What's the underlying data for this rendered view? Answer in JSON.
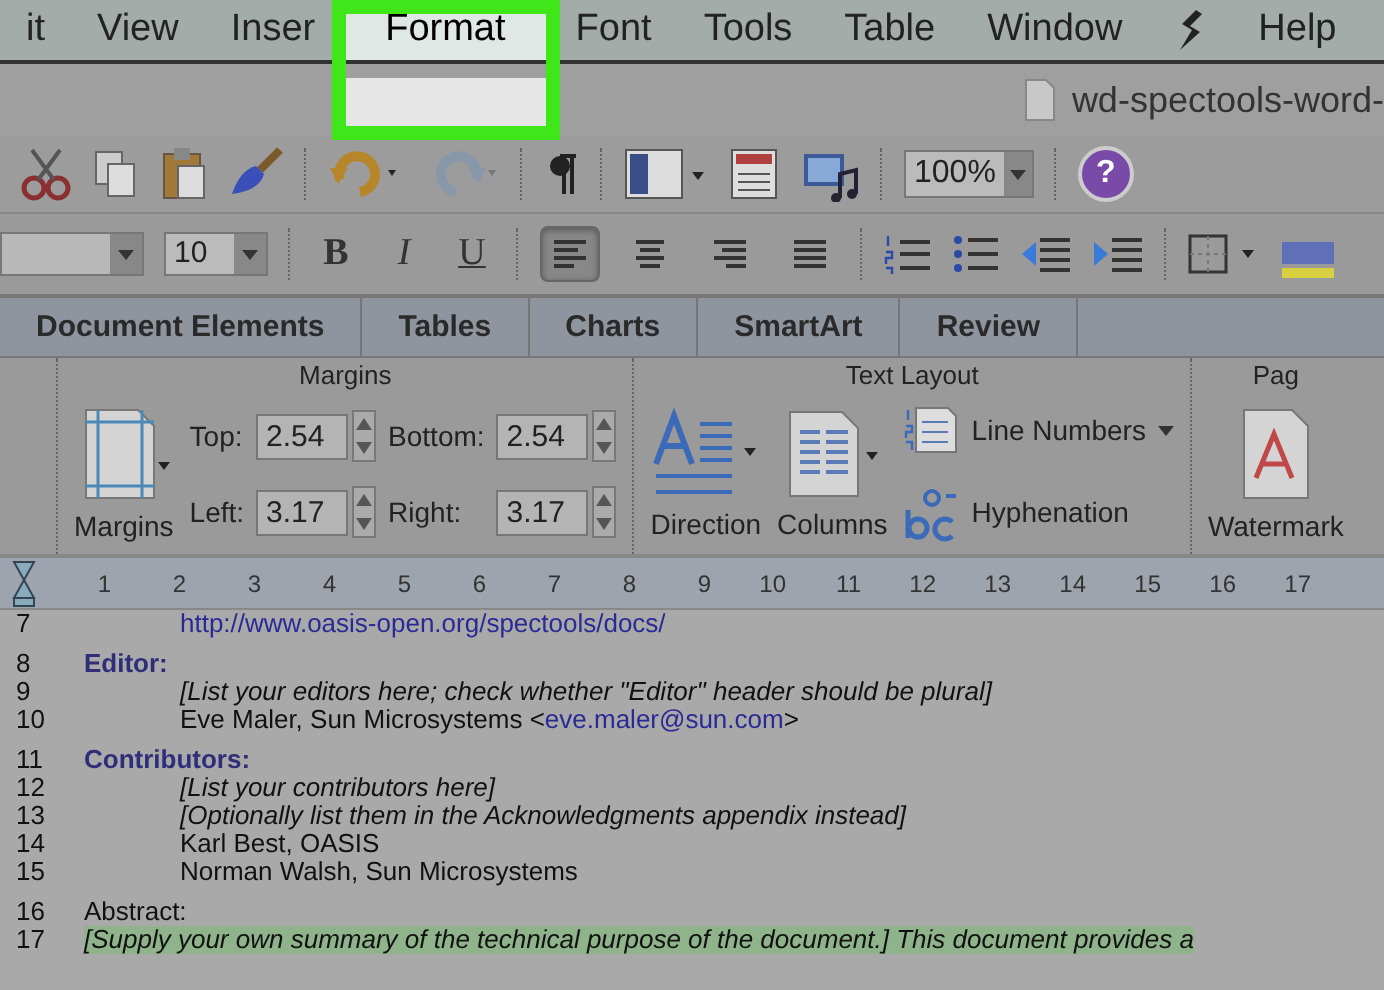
{
  "menu_bar": {
    "items": [
      {
        "kind": "text",
        "label": "it",
        "selected": false
      },
      {
        "kind": "text",
        "label": "View",
        "selected": false
      },
      {
        "kind": "text",
        "label": "Inser",
        "selected": false
      },
      {
        "kind": "text",
        "label": "Format",
        "selected": true
      },
      {
        "kind": "text",
        "label": "Font",
        "selected": false
      },
      {
        "kind": "text",
        "label": "Tools",
        "selected": false
      },
      {
        "kind": "text",
        "label": "Table",
        "selected": false
      },
      {
        "kind": "text",
        "label": "Window",
        "selected": false
      },
      {
        "kind": "icon",
        "selected": false
      },
      {
        "kind": "text",
        "label": "Help",
        "selected": false
      }
    ]
  },
  "document_title": "wd-spectools-word-",
  "toolbar": {
    "zoom": "100%",
    "help": "?"
  },
  "format_bar": {
    "font_size": "10",
    "bold": "B",
    "italic": "I",
    "underline": "U",
    "alignments": [
      {
        "selected": true
      },
      {
        "selected": false
      },
      {
        "selected": false
      },
      {
        "selected": false
      }
    ]
  },
  "ribbon_tabs": [
    {
      "label": "Document Elements",
      "selected": false
    },
    {
      "label": "Tables",
      "selected": false
    },
    {
      "label": "Charts",
      "selected": false
    },
    {
      "label": "SmartArt",
      "selected": false
    },
    {
      "label": "Review",
      "selected": false
    }
  ],
  "margins_group": {
    "title": "Margins",
    "button": "Margins",
    "fields": [
      {
        "label": "Top:",
        "value": "2.54"
      },
      {
        "label": "Bottom:",
        "value": "2.54"
      },
      {
        "label": "Left:",
        "value": "3.17"
      },
      {
        "label": "Right:",
        "value": "3.17"
      }
    ]
  },
  "text_layout_group": {
    "title": "Text Layout",
    "direction": "Direction",
    "columns": "Columns",
    "line_numbers": "Line Numbers",
    "hyphenation": "Hyphenation"
  },
  "page_group": {
    "title": "Pag",
    "watermark": "Watermark"
  },
  "ruler": {
    "ticks": [
      "1",
      "2",
      "3",
      "4",
      "5",
      "6",
      "7",
      "8",
      "9",
      "10",
      "11",
      "12",
      "13",
      "14",
      "15",
      "16",
      "17"
    ]
  },
  "document": {
    "lines": [
      {
        "number": "7",
        "kind": "link",
        "space_before": false,
        "text": "http://www.oasis-open.org/spectools/docs/"
      },
      {
        "number": "8",
        "kind": "heading",
        "space_before": true,
        "text": "Editor:"
      },
      {
        "number": "9",
        "kind": "note",
        "space_before": false,
        "text": "[List your editors here; check whether \"Editor\" header should be plural]"
      },
      {
        "number": "10",
        "kind": "person",
        "space_before": false,
        "text": "Eve Maler, Sun Microsystems <",
        "link": "eve.maler@sun.com",
        "after": ">"
      },
      {
        "number": "11",
        "kind": "heading",
        "space_before": true,
        "text": "Contributors:"
      },
      {
        "number": "12",
        "kind": "note",
        "space_before": false,
        "text": "[List your contributors here]"
      },
      {
        "number": "13",
        "kind": "note",
        "space_before": false,
        "text": "[Optionally list them in the Acknowledgments appendix instead]"
      },
      {
        "number": "14",
        "kind": "plain",
        "space_before": false,
        "text": "Karl Best, OASIS"
      },
      {
        "number": "15",
        "kind": "plain",
        "space_before": false,
        "text": "Norman Walsh, Sun Microsystems"
      },
      {
        "number": "16",
        "kind": "label",
        "space_before": true,
        "text": "Abstract:"
      },
      {
        "number": "17",
        "kind": "highlight",
        "space_before": false,
        "text": "[Supply your own summary of the technical purpose of the document.] This document provides a"
      }
    ]
  }
}
